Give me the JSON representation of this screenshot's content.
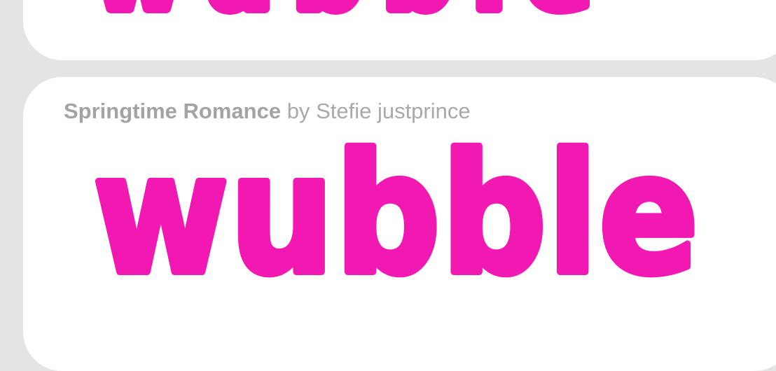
{
  "colors": {
    "page_background": "#e4e4e4",
    "card_background": "#ffffff",
    "meta_text": "#a9a9a9",
    "sample_text": "#f218b2"
  },
  "font_cards": [
    {
      "sample_text": "wubble"
    },
    {
      "font_name": "Springtime Romance",
      "by_label": "by",
      "author": "Stefie justprince",
      "sample_text": "wubble"
    }
  ]
}
